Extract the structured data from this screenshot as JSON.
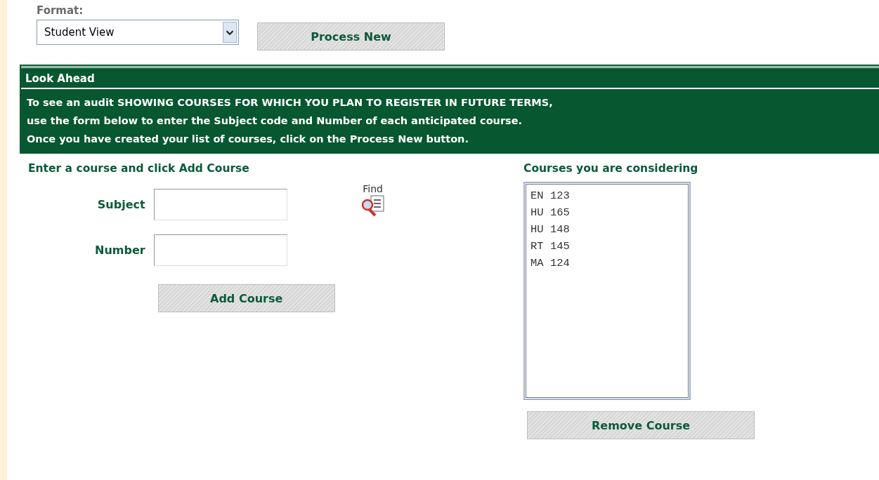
{
  "format": {
    "label": "Format:",
    "value": "Student View"
  },
  "process_button": "Process New",
  "look_ahead": {
    "title": "Look Ahead",
    "lines": [
      "To see an audit SHOWING COURSES FOR WHICH YOU PLAN TO REGISTER IN FUTURE TERMS,",
      "use the form below to enter the Subject code and Number of each anticipated course.",
      "Once you have created your list of courses, click on the Process New button."
    ]
  },
  "entry": {
    "heading": "Enter a course and click Add Course",
    "fields": [
      {
        "label": "Subject"
      },
      {
        "label": "Number"
      }
    ],
    "find_label": "Find",
    "add_button": "Add Course"
  },
  "considering": {
    "heading": "Courses you are considering",
    "courses": [
      "EN 123",
      "HU 165",
      "HU 148",
      "RT 145",
      "MA 124"
    ],
    "remove_button": "Remove Course"
  }
}
